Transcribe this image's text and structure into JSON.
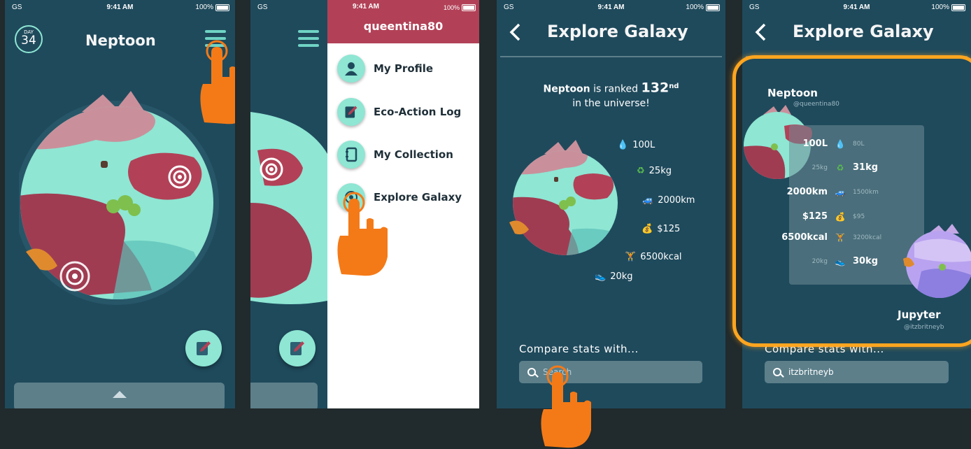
{
  "status": {
    "carrier": "GS",
    "time": "9:41 AM",
    "battery": "100%"
  },
  "screen1": {
    "day_label": "DAY",
    "day_number": "34",
    "title": "Neptoon"
  },
  "screen3": {
    "header": "queentina80",
    "menu": [
      "My Profile",
      "Eco-Action Log",
      "My Collection",
      "Explore Galaxy"
    ]
  },
  "screen4": {
    "title": "Explore Galaxy",
    "rank_name": "Neptoon",
    "rank_text": "is ranked",
    "rank_number": "132",
    "rank_suffix": "nd",
    "rank_line2": "in the universe!",
    "stats": [
      "100L",
      "25kg",
      "2000km",
      "$125",
      "6500kcal",
      "20kg"
    ],
    "compare_label": "Compare stats with...",
    "search_placeholder": "Search"
  },
  "screen5": {
    "title": "Explore Galaxy",
    "planet1_name": "Neptoon",
    "planet1_user": "@queentina80",
    "planet2_name": "Jupyter",
    "planet2_user": "@itzbritneyb",
    "compare": [
      {
        "left": "100L",
        "icon": "💧",
        "right": "80L",
        "left_big": true
      },
      {
        "left": "25kg",
        "icon": "♻",
        "right": "31kg",
        "left_big": false
      },
      {
        "left": "2000km",
        "icon": "🚙",
        "right": "1500km",
        "left_big": true
      },
      {
        "left": "$125",
        "icon": "💰",
        "right": "$95",
        "left_big": true
      },
      {
        "left": "6500kcal",
        "icon": "🏋",
        "right": "3200kcal",
        "left_big": true
      },
      {
        "left": "20kg",
        "icon": "👟",
        "right": "30kg",
        "left_big": false
      }
    ],
    "compare_label": "Compare stats with...",
    "search_value": "itzbritneyb"
  },
  "colors": {
    "bg": "#1f4a5c",
    "accent": "#8ee6d3",
    "planet_red": "#b24157",
    "hand": "#f47a17",
    "highlight": "#ffa51f"
  }
}
